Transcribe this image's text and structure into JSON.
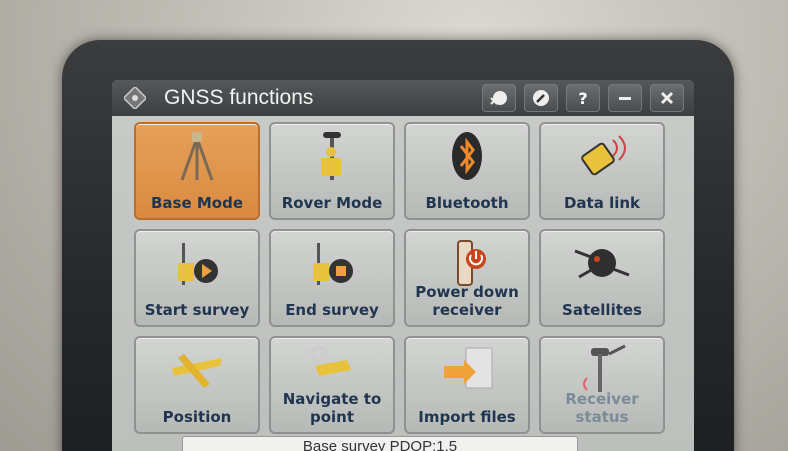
{
  "window": {
    "title": "GNSS functions",
    "icons": [
      "app-menu-icon",
      "satellite-off-icon",
      "edit-icon",
      "help-icon",
      "minimize-icon",
      "close-icon"
    ],
    "help_label": "?"
  },
  "colors": {
    "active_tile": "#d98a3f",
    "tile": "#c6c8c6",
    "label": "#1f3550",
    "titlebar": "#45484a"
  },
  "tiles": [
    {
      "label": "Base Mode",
      "icon": "tripod-base-icon",
      "active": true
    },
    {
      "label": "Rover Mode",
      "icon": "rover-pole-icon"
    },
    {
      "label": "Bluetooth",
      "icon": "bluetooth-icon"
    },
    {
      "label": "Data link",
      "icon": "radio-link-icon",
      "dim": true
    },
    {
      "label": "Start survey",
      "icon": "start-survey-icon"
    },
    {
      "label": "End survey",
      "icon": "end-survey-icon"
    },
    {
      "label": "Power down receiver",
      "icon": "power-down-icon"
    },
    {
      "label": "Satellites",
      "icon": "satellite-icon"
    },
    {
      "label": "Position",
      "icon": "position-icon"
    },
    {
      "label": "Navigate to point",
      "icon": "navigate-icon"
    },
    {
      "label": "Import files",
      "icon": "import-files-icon"
    },
    {
      "label": "Receiver status",
      "icon": "receiver-status-icon"
    }
  ],
  "status": {
    "text": "Base survey  PDOP:1.5"
  }
}
